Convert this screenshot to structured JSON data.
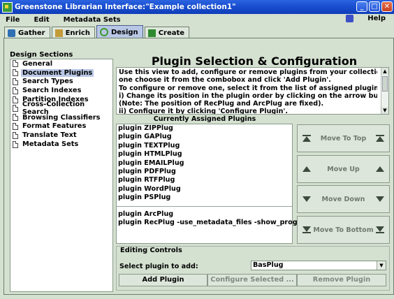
{
  "window": {
    "title": "Greenstone Librarian Interface:\"Example collection1\"",
    "buttons": {
      "minimize": "_",
      "maximize": "□",
      "close": "✕"
    }
  },
  "menu": {
    "items": [
      "File",
      "Edit",
      "Metadata Sets"
    ],
    "help": "Help"
  },
  "tabs": [
    {
      "label": "Gather",
      "icon": "gather-icon"
    },
    {
      "label": "Enrich",
      "icon": "enrich-icon"
    },
    {
      "label": "Design",
      "icon": "design-icon",
      "active": true
    },
    {
      "label": "Create",
      "icon": "create-icon"
    }
  ],
  "sidebar": {
    "title": "Design Sections",
    "items": [
      "General",
      "Document Plugins",
      "Search Types",
      "Search Indexes",
      "Partition Indexes",
      "Cross-Collection Search",
      "Browsing Classifiers",
      "Format Features",
      "Translate Text",
      "Metadata Sets"
    ],
    "selected_index": 1
  },
  "main": {
    "title": "Plugin Selection & Configuration",
    "help_lines": [
      "Use this view to add, configure or remove plugins from your collection. To add",
      "one choose it from the combobox and click 'Add Plugin'.",
      "To configure or remove one, select it from the list of assigned plugins then:",
      "i)  Change its position in the plugin order by clicking on the arrow buttons.",
      "(Note: The position of RecPlug and ArcPlug are fixed).",
      "ii)  Configure it by clicking 'Configure Plugin'."
    ],
    "assigned_title": "Currently Assigned Plugins",
    "plugins": [
      "plugin ZIPPlug",
      "plugin GAPlug",
      "plugin TEXTPlug",
      "plugin HTMLPlug",
      "plugin EMAILPlug",
      "plugin PDFPlug",
      "plugin RTFPlug",
      "plugin WordPlug",
      "plugin PSPlug"
    ],
    "fixed_plugins": [
      "plugin ArcPlug",
      "plugin RecPlug -use_metadata_files -show_progress"
    ],
    "move_buttons": [
      {
        "label": "Move To Top"
      },
      {
        "label": "Move Up"
      },
      {
        "label": "Move Down"
      },
      {
        "label": "Move To Bottom"
      }
    ]
  },
  "editing": {
    "title": "Editing Controls",
    "select_label": "Select plugin to add:",
    "selected_plugin": "BasPlug",
    "add_label": "Add Plugin",
    "configure_label": "Configure Selected ...",
    "remove_label": "Remove Plugin"
  },
  "colors": {
    "title_bar": "#1a4fd0",
    "panel": "#d4e0d0",
    "selection": "#b9c7e6"
  }
}
